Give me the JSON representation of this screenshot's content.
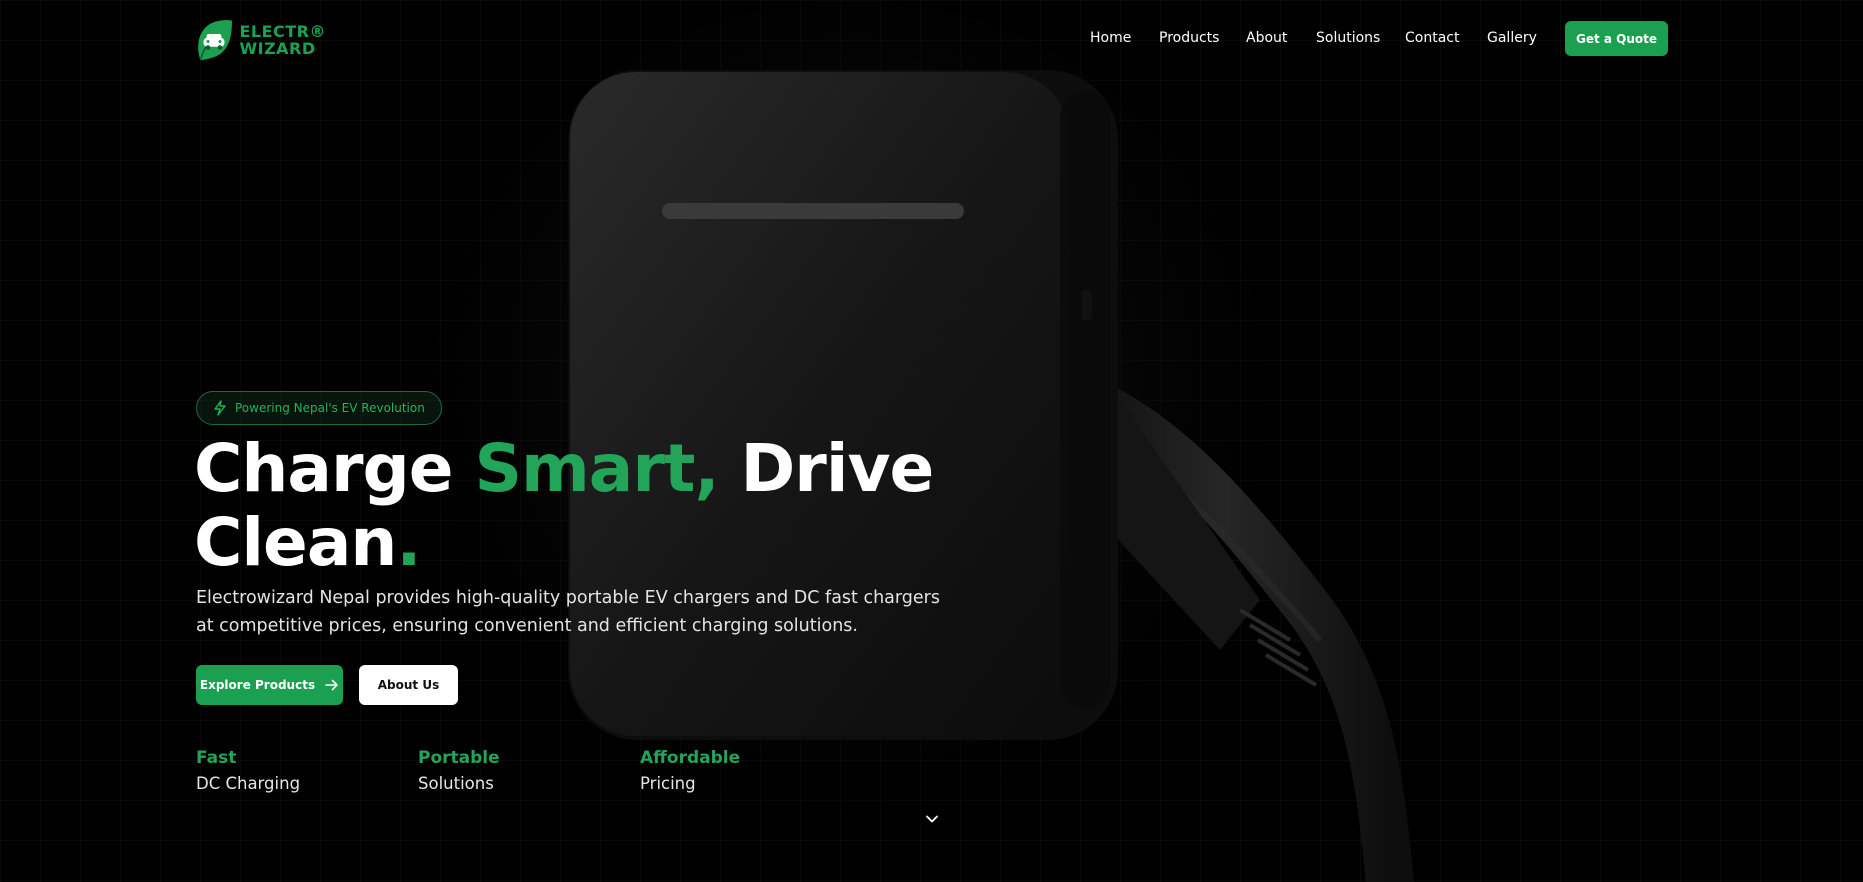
{
  "brand": {
    "line1": "ELECTR®",
    "line2": "WIZARD",
    "logo_icon": "leaf-car-icon",
    "color": "#1aa251"
  },
  "nav": {
    "items": [
      {
        "label": "Home"
      },
      {
        "label": "Products"
      },
      {
        "label": "About"
      },
      {
        "label": "Solutions"
      },
      {
        "label": "Contact"
      },
      {
        "label": "Gallery"
      }
    ],
    "cta": "Get a Quote"
  },
  "hero": {
    "badge": "Powering Nepal's EV Revolution",
    "badge_icon": "lightning-icon",
    "title_part1": "Charge ",
    "title_accent": "Smart,",
    "title_part2": " Drive",
    "title_line2": "Clean",
    "title_dot": ".",
    "description": "Electrowizard Nepal provides high-quality portable EV chargers and DC fast chargers at competitive prices, ensuring convenient and efficient charging solutions.",
    "primary_button": "Explore Products",
    "secondary_button": "About Us"
  },
  "features": [
    {
      "title": "Fast",
      "subtitle": "DC Charging"
    },
    {
      "title": "Portable",
      "subtitle": "Solutions"
    },
    {
      "title": "Affordable",
      "subtitle": "Pricing"
    }
  ],
  "colors": {
    "accent": "#22a559",
    "button": "#1b9f50",
    "background": "#000000"
  }
}
